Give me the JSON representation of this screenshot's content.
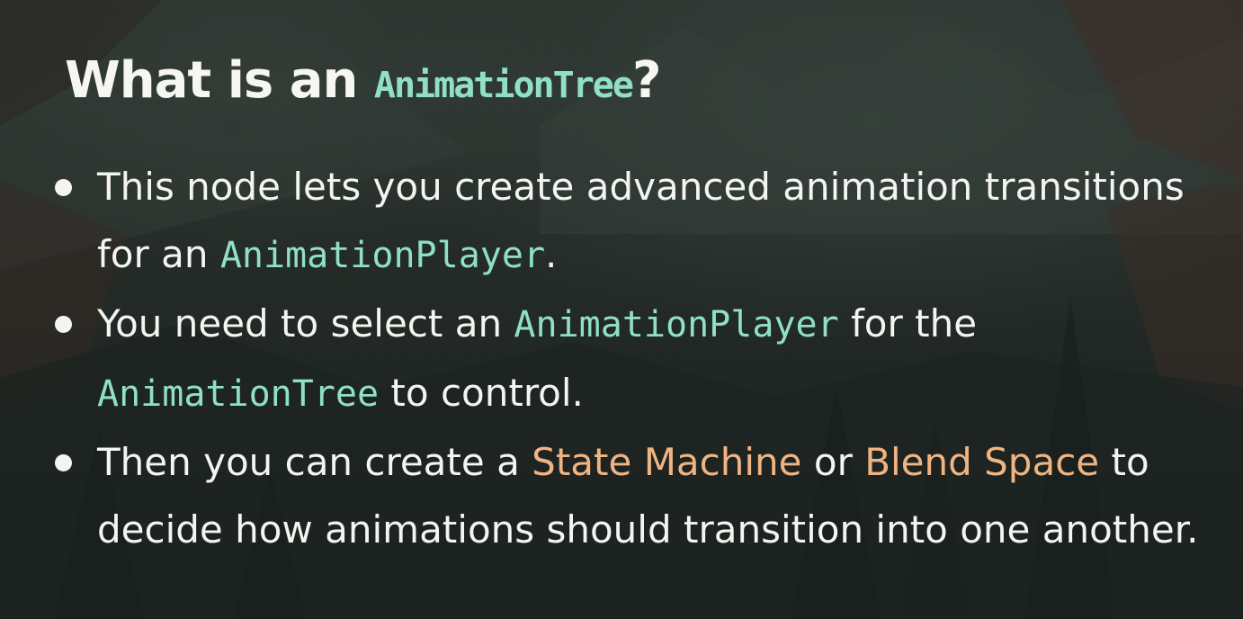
{
  "slide": {
    "title": {
      "prefix": "What is an ",
      "code": "AnimationTree",
      "suffix": "?"
    },
    "bullets": [
      {
        "t1": "This node lets you create advanced animation transitions for an ",
        "code1": "AnimationPlayer",
        "t2": "."
      },
      {
        "t1": "You need to select an ",
        "code1": "AnimationPlayer",
        "t2": " for the ",
        "code2": "AnimationTree",
        "t3": " to control."
      },
      {
        "t1": "Then you can create a ",
        "hl1": "State Machine",
        "t2": " or ",
        "hl2": "Blend Space",
        "t3": " to decide how animations should transition into one another."
      }
    ]
  },
  "colors": {
    "text": "#f4f4f0",
    "code": "#8fe0c4",
    "highlight": "#f0b483",
    "background": "#2f3733"
  }
}
